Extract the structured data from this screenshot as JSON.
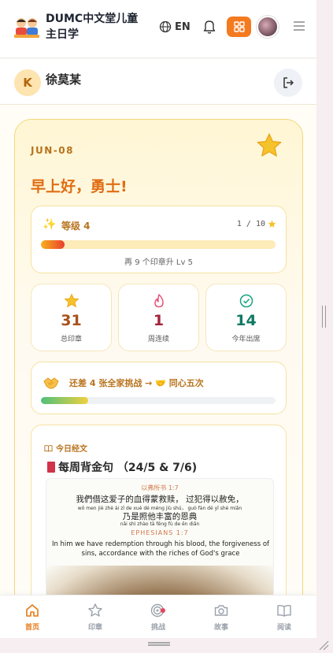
{
  "header": {
    "brand": "DUMC中文堂儿童主日学",
    "language": "EN"
  },
  "user": {
    "initial": "K",
    "name": "徐莫某"
  },
  "dashboard": {
    "date": "JUN-08",
    "greeting": "早上好，勇士!",
    "level": {
      "label": "等级 4",
      "progress_text": "1 / 10",
      "progress_fraction": 0.1,
      "hint": "再 9 个印章升 Lv 5"
    },
    "stats": [
      {
        "value": "31",
        "label": "总印章",
        "icon": "star-icon",
        "color": "#a8511a"
      },
      {
        "value": "1",
        "label": "周连续",
        "icon": "flame-icon",
        "color": "#a3233a"
      },
      {
        "value": "14",
        "label": "今年出席",
        "icon": "check-circle-icon",
        "color": "#0f7a62"
      }
    ],
    "challenge": {
      "text": "还差 4 张全家挑战 → 🤝 同心五次",
      "progress_fraction": 0.2
    },
    "verse": {
      "section_label": "今日经文",
      "title": "每周背金句 （24/5 & 7/6)",
      "ref_cn": "以弗所书 1:7",
      "line_cn_1": "我們借这爱子的血得蒙救赎， 过犯得以赦免，",
      "pinyin_1": "wǒ men jiè zhè ài zǐ de xuè dé méng jiù shú，   guò fàn dé yǐ shè miǎn",
      "line_cn_2": "乃是照他丰富的恩典",
      "pinyin_2": "nǎi shì zhào tā fēng fù de ēn diǎn",
      "ref_en": "EPHESIANS 1:7",
      "line_en": "In him we have redemption through his blood, the forgiveness of sins, accordance with the riches of God's grace"
    }
  },
  "nav": [
    {
      "label": "首页",
      "icon": "home-icon",
      "active": true
    },
    {
      "label": "印章",
      "icon": "star-outline-icon",
      "active": false
    },
    {
      "label": "挑战",
      "icon": "target-icon",
      "active": false
    },
    {
      "label": "故事",
      "icon": "camera-icon",
      "active": false
    },
    {
      "label": "阅读",
      "icon": "book-icon",
      "active": false
    }
  ],
  "colors": {
    "accent": "#f47a20",
    "title_brown": "#b8731d",
    "greeting_orange": "#e06d12"
  }
}
